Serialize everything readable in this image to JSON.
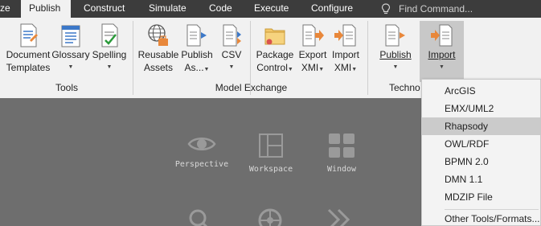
{
  "menubar": {
    "tabs": [
      {
        "label": "ze"
      },
      {
        "label": "Publish"
      },
      {
        "label": "Construct"
      },
      {
        "label": "Simulate"
      },
      {
        "label": "Code"
      },
      {
        "label": "Execute"
      },
      {
        "label": "Configure"
      }
    ],
    "search_placeholder": "Find Command..."
  },
  "ribbon": {
    "groups": {
      "tools": "Tools",
      "model_exchange": "Model Exchange",
      "technology": "Techno"
    },
    "buttons": {
      "document_templates": [
        "Document",
        "Templates"
      ],
      "glossary": "Glossary",
      "spelling": "Spelling",
      "reusable_assets": [
        "Reusable",
        "Assets"
      ],
      "publish_as": [
        "Publish",
        "As..."
      ],
      "csv": "CSV",
      "package_control": [
        "Package",
        "Control"
      ],
      "export_xmi": [
        "Export",
        "XMI"
      ],
      "import_xmi": [
        "Import",
        "XMI"
      ],
      "publish": "Publish",
      "import": "Import"
    }
  },
  "canvas": {
    "items": [
      {
        "label": "Perspective"
      },
      {
        "label": "Workspace"
      },
      {
        "label": "Window"
      }
    ]
  },
  "dropdown": {
    "items": [
      "ArcGIS",
      "EMX/UML2",
      "Rhapsody",
      "OWL/RDF",
      "BPMN 2.0",
      "DMN 1.1",
      "MDZIP File"
    ],
    "other": "Other Tools/Formats..."
  },
  "colors": {
    "menubar_bg": "#3c3c3c",
    "ribbon_bg": "#f1f1f1",
    "canvas_bg": "#6e6e6e",
    "accent_orange": "#e8873a",
    "accent_blue": "#3c78c8"
  }
}
